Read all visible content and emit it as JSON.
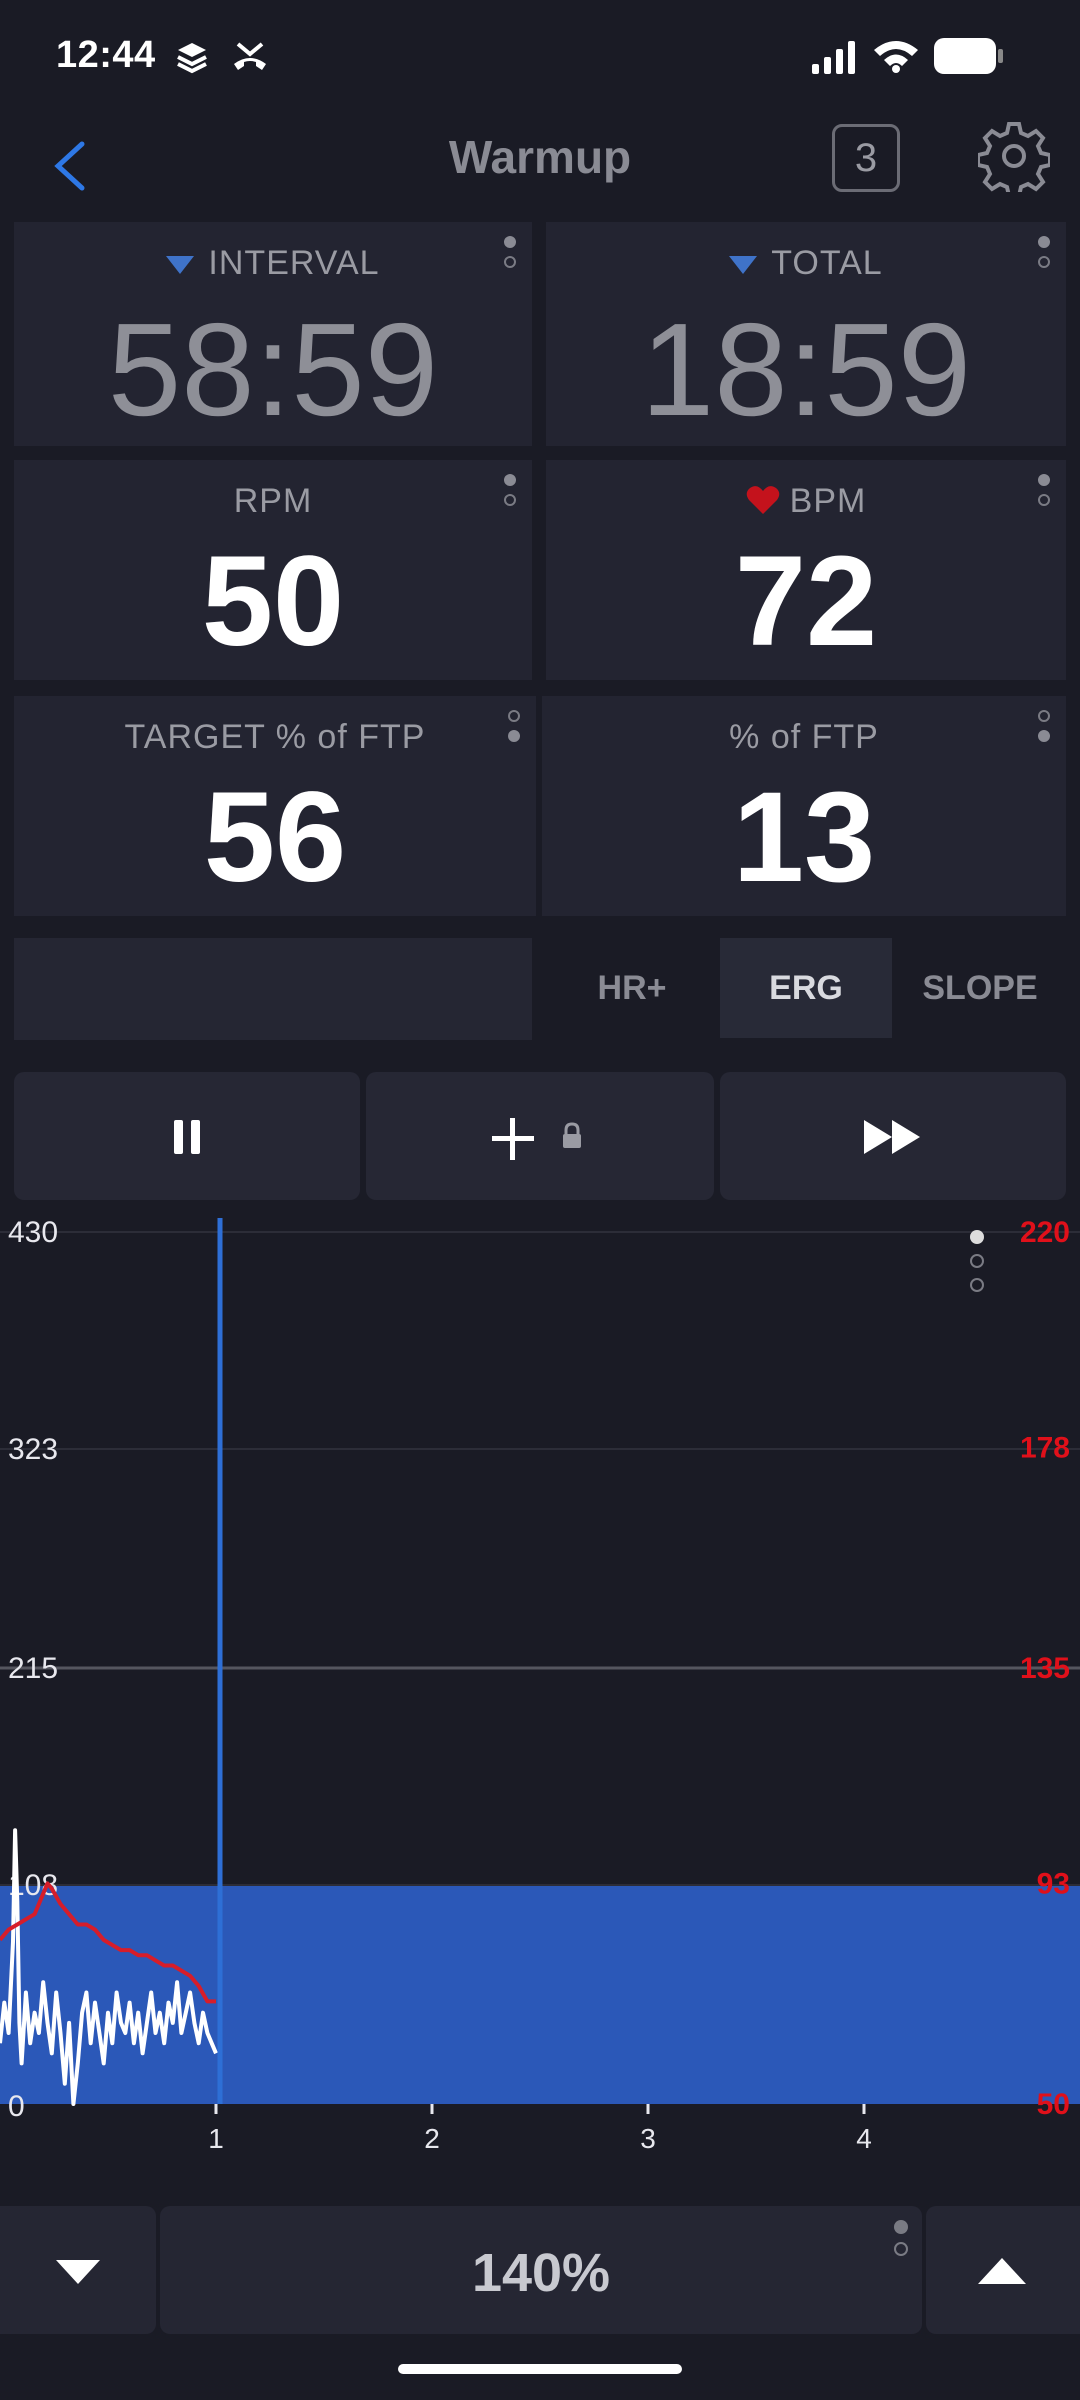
{
  "status_bar": {
    "time": "12:44"
  },
  "header": {
    "title": "Warmup",
    "badge": "3"
  },
  "tiles": {
    "interval": {
      "label": "INTERVAL",
      "value": "58:59"
    },
    "total": {
      "label": "TOTAL",
      "value": "18:59"
    },
    "rpm": {
      "label": "RPM",
      "value": "50"
    },
    "bpm": {
      "label": "BPM",
      "value": "72"
    },
    "target_ftp": {
      "label": "TARGET % of FTP",
      "value": "56"
    },
    "ftp": {
      "label": "% of FTP",
      "value": "13"
    }
  },
  "modes": {
    "hr": "HR+",
    "erg": "ERG",
    "slope": "SLOPE",
    "active": "ERG"
  },
  "controls": {
    "pause": "pause",
    "add": "add-locked",
    "skip": "fast-forward"
  },
  "chart_data": {
    "type": "line",
    "left_axis": {
      "ticks": [
        430,
        323,
        215,
        108,
        0
      ],
      "range": [
        0,
        430
      ]
    },
    "right_axis": {
      "ticks": [
        220,
        178,
        135,
        93,
        50
      ],
      "range": [
        50,
        220
      ],
      "color": "#e0101a"
    },
    "x_axis": {
      "ticks": [
        1,
        2,
        3,
        4
      ],
      "range": [
        0,
        5
      ]
    },
    "target_block": {
      "x_start": 0,
      "x_end": 5,
      "value": 108,
      "color": "#2b58b8"
    },
    "current_x": 1,
    "series": [
      {
        "color": "#ffffff",
        "axis": "left",
        "x": [
          0,
          0.02,
          0.04,
          0.06,
          0.07,
          0.08,
          0.09,
          0.1,
          0.12,
          0.14,
          0.16,
          0.18,
          0.2,
          0.22,
          0.24,
          0.26,
          0.28,
          0.3,
          0.32,
          0.34,
          0.36,
          0.38,
          0.4,
          0.42,
          0.44,
          0.46,
          0.48,
          0.5,
          0.52,
          0.54,
          0.56,
          0.58,
          0.6,
          0.62,
          0.64,
          0.66,
          0.68,
          0.7,
          0.72,
          0.74,
          0.76,
          0.78,
          0.8,
          0.82,
          0.84,
          0.86,
          0.88,
          0.9,
          0.92,
          0.94,
          0.96,
          0.98,
          1.0
        ],
        "y": [
          30,
          50,
          35,
          80,
          135,
          100,
          40,
          20,
          55,
          30,
          45,
          35,
          60,
          40,
          25,
          55,
          35,
          10,
          40,
          0,
          20,
          45,
          55,
          30,
          50,
          35,
          20,
          45,
          30,
          55,
          40,
          35,
          50,
          30,
          45,
          25,
          40,
          55,
          35,
          45,
          30,
          50,
          40,
          60,
          35,
          45,
          55,
          40,
          30,
          45,
          35,
          30,
          25
        ]
      },
      {
        "color": "#d61d2a",
        "axis": "right",
        "x": [
          0,
          0.04,
          0.08,
          0.12,
          0.16,
          0.2,
          0.22,
          0.24,
          0.28,
          0.32,
          0.36,
          0.4,
          0.44,
          0.48,
          0.52,
          0.56,
          0.6,
          0.64,
          0.68,
          0.72,
          0.76,
          0.8,
          0.84,
          0.88,
          0.92,
          0.96,
          1.0
        ],
        "y": [
          82,
          84,
          85,
          86,
          87,
          91,
          93,
          92,
          89,
          87,
          85,
          85,
          84,
          82,
          81,
          80,
          80,
          79,
          79,
          78,
          77,
          77,
          76,
          75,
          73,
          70,
          70
        ]
      }
    ]
  },
  "bottom_bar": {
    "zoom": "140%"
  }
}
